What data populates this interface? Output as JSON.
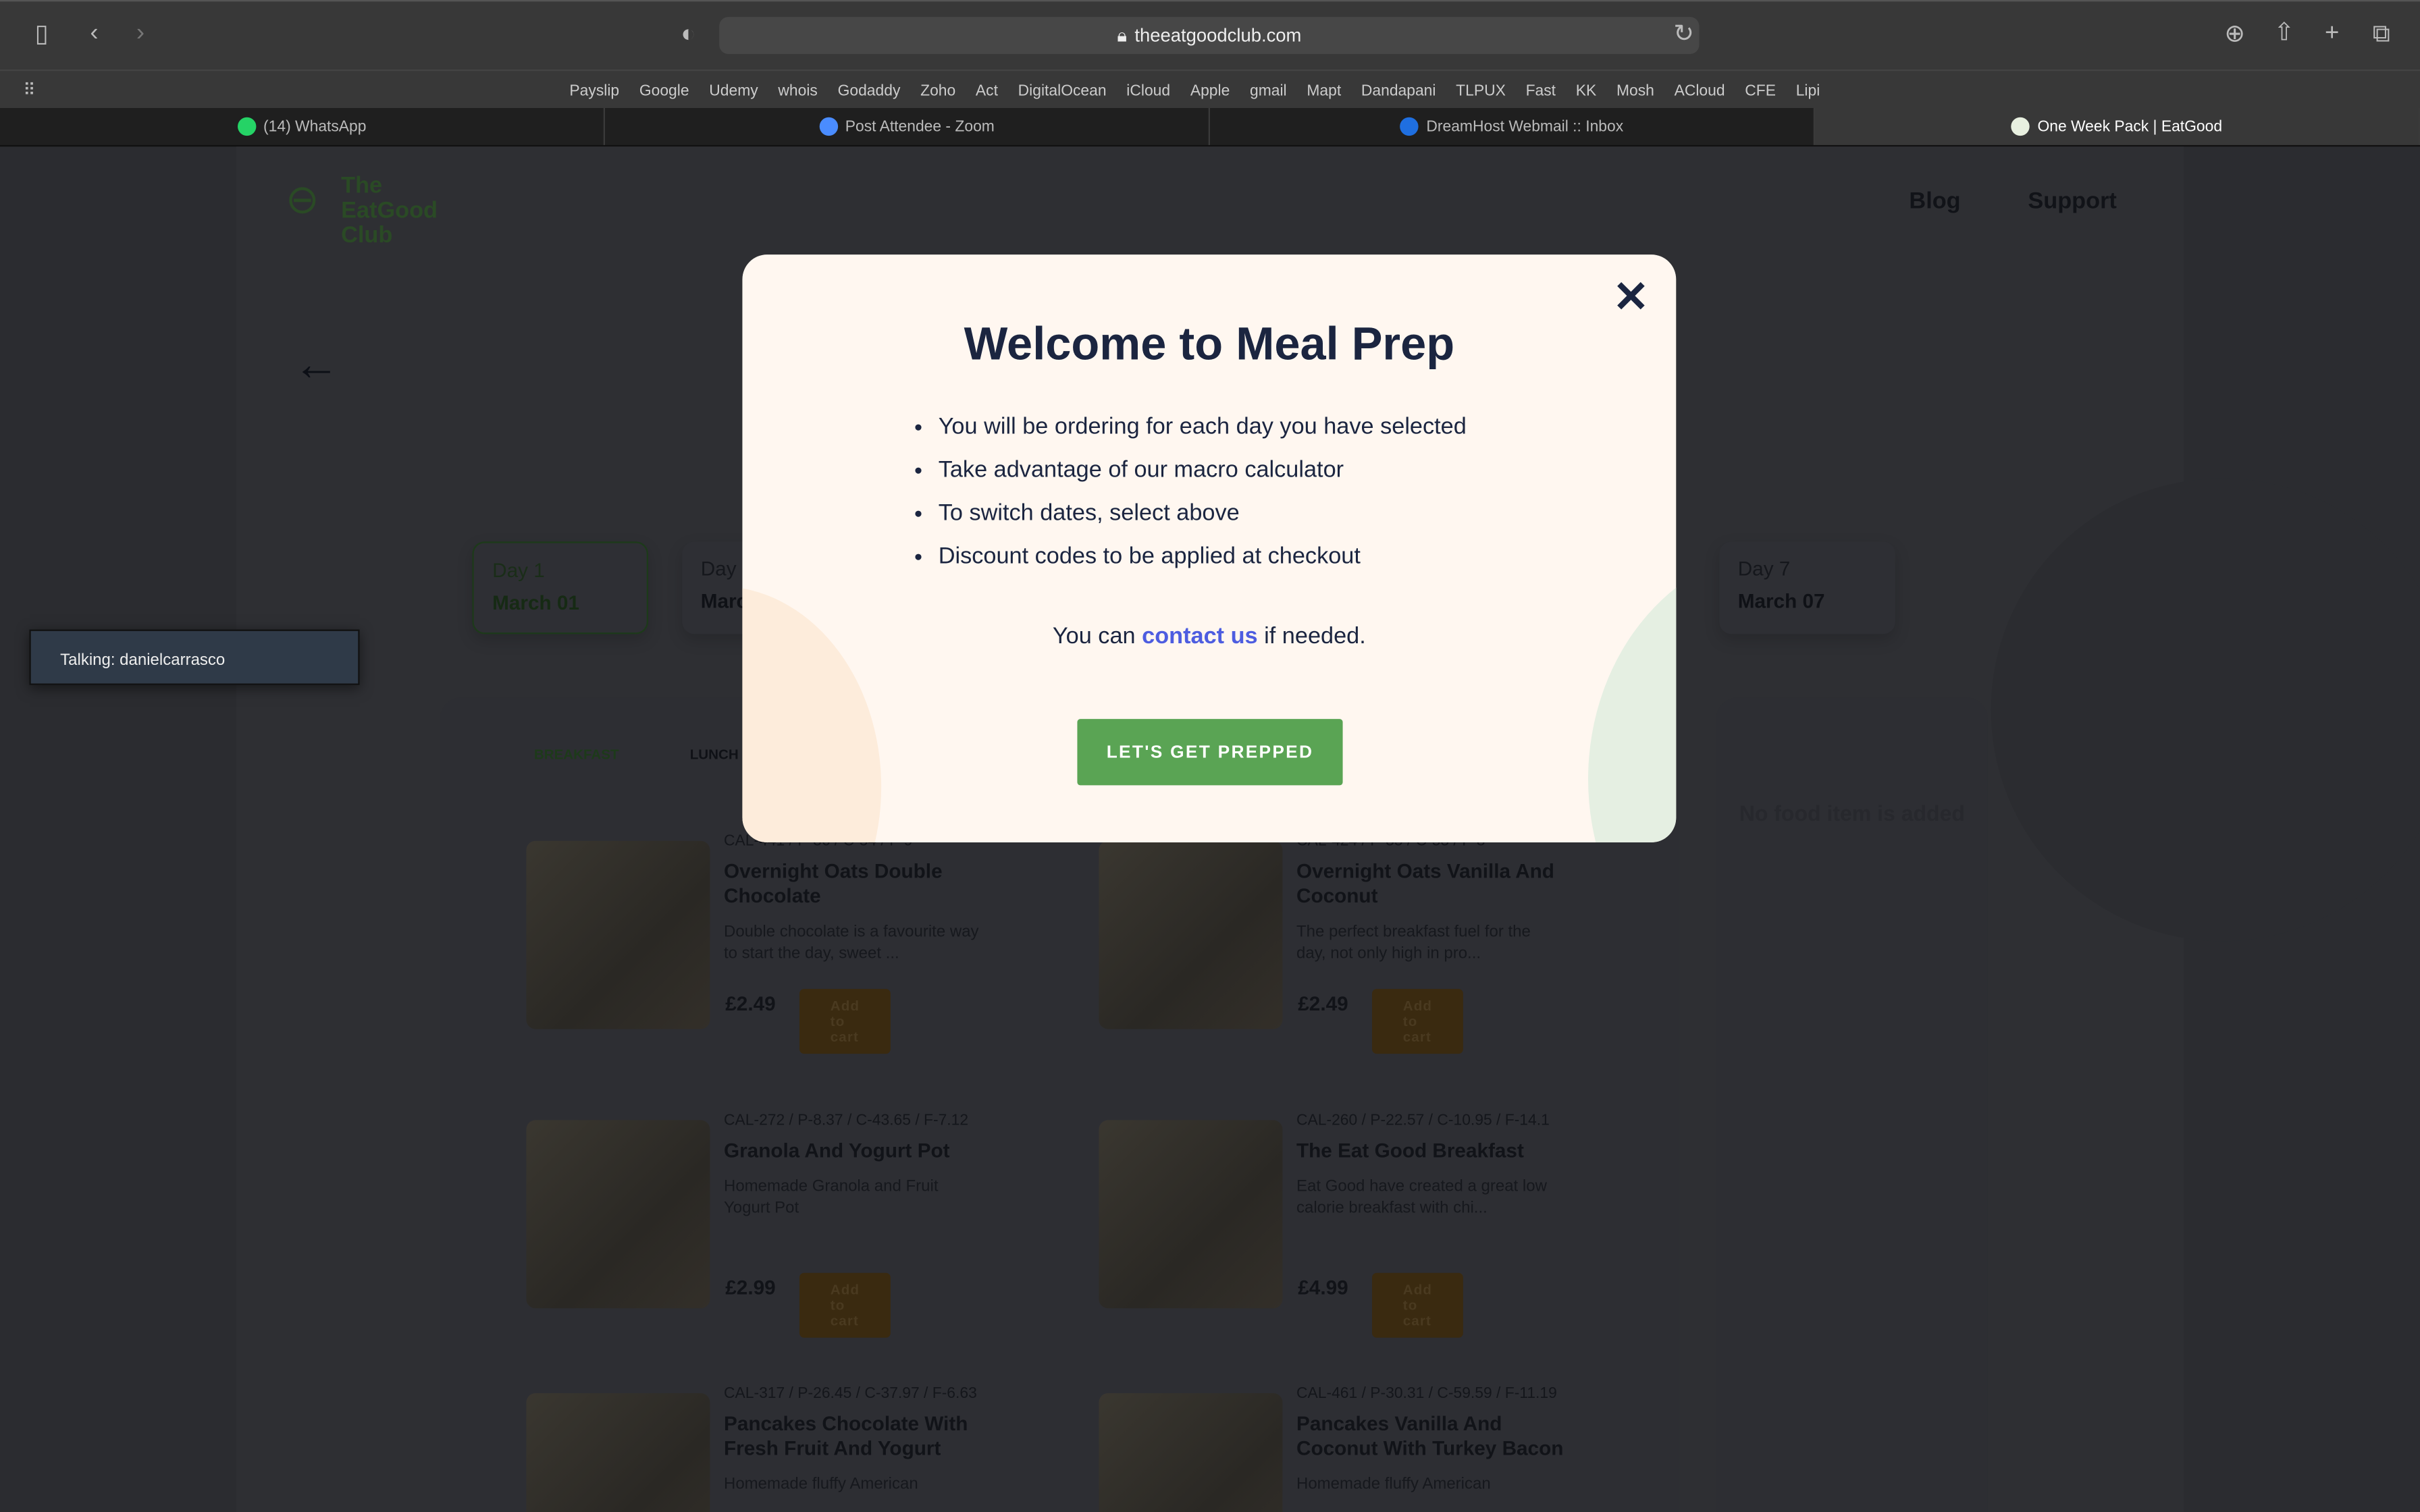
{
  "browser": {
    "url": "theeatgoodclub.com",
    "bookmarks": [
      "Payslip",
      "Google",
      "Udemy",
      "whois",
      "Godaddy",
      "Zoho",
      "Act",
      "DigitalOcean",
      "iCloud",
      "Apple",
      "gmail",
      "Mapt",
      "Dandapani",
      "TLPUX",
      "Fast",
      "KK",
      "Mosh",
      "ACloud",
      "CFE",
      "Lipi"
    ],
    "tabs": [
      {
        "label": "(14) WhatsApp",
        "color": "#25d366"
      },
      {
        "label": "Post Attendee - Zoom",
        "color": "#4a8cff"
      },
      {
        "label": "DreamHost Webmail :: Inbox",
        "color": "#1f6fe0"
      },
      {
        "label": "One Week Pack | EatGood",
        "color": "#e8f0e0",
        "active": true
      }
    ]
  },
  "site": {
    "logo": "The EatGood Club",
    "nav": [
      "Blog",
      "Support"
    ],
    "days": [
      {
        "day": "Day 1",
        "date": "March 01"
      },
      {
        "day": "Day",
        "date": "Marc"
      },
      {
        "day": "Day 7",
        "date": "March 07"
      }
    ],
    "meal_tabs": [
      "BREAKFAST",
      "LUNCH"
    ],
    "empty_cart": "No food item is added",
    "products": [
      {
        "macros": "CAL-441 / P-36 / C-54 / F-9",
        "name": "Overnight Oats Double Chocolate",
        "desc": "Double chocolate is a favourite way to start the day, sweet ...",
        "price": "£2.49",
        "cta": "Add to cart"
      },
      {
        "macros": "CAL-424 / P-35 / C-53 / F-8",
        "name": "Overnight Oats Vanilla And Coconut",
        "desc": "The perfect breakfast fuel for the day, not only high in pro...",
        "price": "£2.49",
        "cta": "Add to cart"
      },
      {
        "macros": "CAL-272 / P-8.37 / C-43.65 / F-7.12",
        "name": "Granola And Yogurt Pot",
        "desc": "Homemade Granola and Fruit Yogurt Pot",
        "price": "£2.99",
        "cta": "Add to cart"
      },
      {
        "macros": "CAL-260 / P-22.57 / C-10.95 / F-14.1",
        "name": "The Eat Good Breakfast",
        "desc": "Eat Good have created a great low calorie breakfast with chi...",
        "price": "£4.99",
        "cta": "Add to cart"
      },
      {
        "macros": "CAL-317 / P-26.45 / C-37.97 / F-6.63",
        "name": "Pancakes Chocolate With Fresh Fruit And Yogurt",
        "desc": "Homemade fluffy American",
        "price": "",
        "cta": ""
      },
      {
        "macros": "CAL-461 / P-30.31 / C-59.59 / F-11.19",
        "name": "Pancakes Vanilla And Coconut With Turkey Bacon",
        "desc": "Homemade fluffy American",
        "price": "",
        "cta": ""
      }
    ]
  },
  "talking": "Talking: danielcarrasco",
  "modal": {
    "title": "Welcome to Meal Prep",
    "bullets": [
      "You will be ordering for each day you have selected",
      "Take advantage of our macro calculator",
      "To switch dates, select above",
      "Discount codes to be applied at checkout"
    ],
    "note_pre": "You can",
    "note_link": "contact us",
    "note_post": "if needed.",
    "button": "LET'S GET PREPPED"
  }
}
